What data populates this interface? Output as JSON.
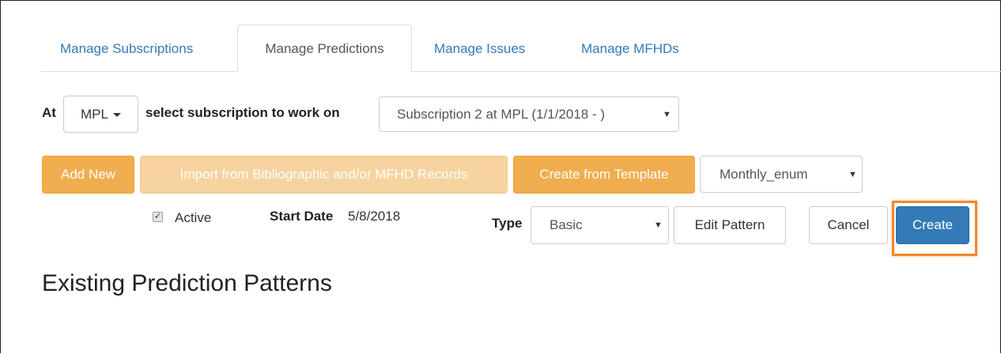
{
  "tabs": [
    {
      "label": "Manage Subscriptions"
    },
    {
      "label": "Manage Predictions"
    },
    {
      "label": "Manage Issues"
    },
    {
      "label": "Manage MFHDs"
    }
  ],
  "at_label": "At",
  "library_dropdown": {
    "value": "MPL"
  },
  "select_subscription_label": "select subscription to work on",
  "subscription_select": {
    "value": "Subscription 2 at MPL (1/1/2018 - )"
  },
  "buttons": {
    "add_new": "Add New",
    "import": "Import from Bibliographic and/or MFHD Records",
    "create_from_template": "Create from Template",
    "edit_pattern": "Edit Pattern",
    "cancel": "Cancel",
    "create": "Create"
  },
  "template_select": {
    "value": "Monthly_enum"
  },
  "active": {
    "label": "Active",
    "checked": true
  },
  "start_date": {
    "label": "Start Date",
    "value": "5/8/2018"
  },
  "type": {
    "label": "Type",
    "value": "Basic"
  },
  "section_heading": "Existing Prediction Patterns",
  "colors": {
    "link": "#337ab7",
    "warning": "#f0ad4e",
    "warning_disabled": "#f7d39f",
    "primary": "#337ab7",
    "highlight": "#f0882c"
  },
  "icons": {
    "checkbox": "checkmark-icon",
    "select_caret": "caret-down-icon"
  }
}
